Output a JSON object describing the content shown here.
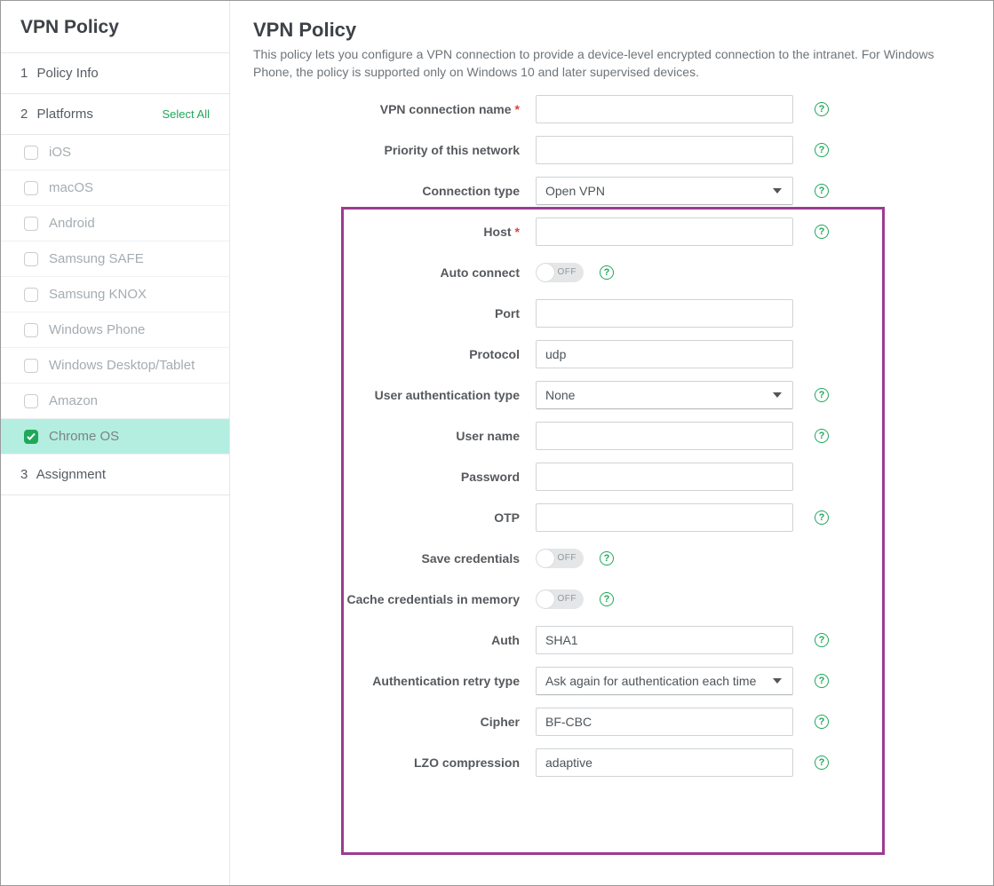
{
  "sidebar": {
    "title": "VPN Policy",
    "steps": {
      "policy_info": {
        "num": "1",
        "label": "Policy Info"
      },
      "platforms": {
        "num": "2",
        "label": "Platforms",
        "select_all": "Select All"
      },
      "assignment": {
        "num": "3",
        "label": "Assignment"
      }
    },
    "platforms": [
      {
        "label": "iOS",
        "selected": false
      },
      {
        "label": "macOS",
        "selected": false
      },
      {
        "label": "Android",
        "selected": false
      },
      {
        "label": "Samsung SAFE",
        "selected": false
      },
      {
        "label": "Samsung KNOX",
        "selected": false
      },
      {
        "label": "Windows Phone",
        "selected": false
      },
      {
        "label": "Windows Desktop/Tablet",
        "selected": false
      },
      {
        "label": "Amazon",
        "selected": false
      },
      {
        "label": "Chrome OS",
        "selected": true
      }
    ]
  },
  "main": {
    "title": "VPN Policy",
    "description": "This policy lets you configure a VPN connection to provide a device-level encrypted connection to the intranet. For Windows Phone, the policy is supported only on Windows 10 and later supervised devices.",
    "fields": {
      "vpn_name": {
        "label": "VPN connection name",
        "required": true,
        "value": ""
      },
      "priority": {
        "label": "Priority of this network",
        "value": ""
      },
      "conn_type": {
        "label": "Connection type",
        "value": "Open VPN"
      },
      "host": {
        "label": "Host",
        "required": true,
        "value": ""
      },
      "auto_connect": {
        "label": "Auto connect",
        "toggle": "OFF"
      },
      "port": {
        "label": "Port",
        "value": ""
      },
      "protocol": {
        "label": "Protocol",
        "value": "udp"
      },
      "user_auth_type": {
        "label": "User authentication type",
        "value": "None"
      },
      "user_name": {
        "label": "User name",
        "value": ""
      },
      "password": {
        "label": "Password",
        "value": ""
      },
      "otp": {
        "label": "OTP",
        "value": ""
      },
      "save_creds": {
        "label": "Save credentials",
        "toggle": "OFF"
      },
      "cache_creds": {
        "label": "Cache credentials in memory",
        "toggle": "OFF"
      },
      "auth": {
        "label": "Auth",
        "value": "SHA1"
      },
      "auth_retry": {
        "label": "Authentication retry type",
        "value": "Ask again for authentication each time"
      },
      "cipher": {
        "label": "Cipher",
        "value": "BF-CBC"
      },
      "lzo": {
        "label": "LZO compression",
        "value": "adaptive"
      }
    }
  },
  "colors": {
    "accent": "#1fa85a",
    "highlight_border": "#9d3b91"
  }
}
